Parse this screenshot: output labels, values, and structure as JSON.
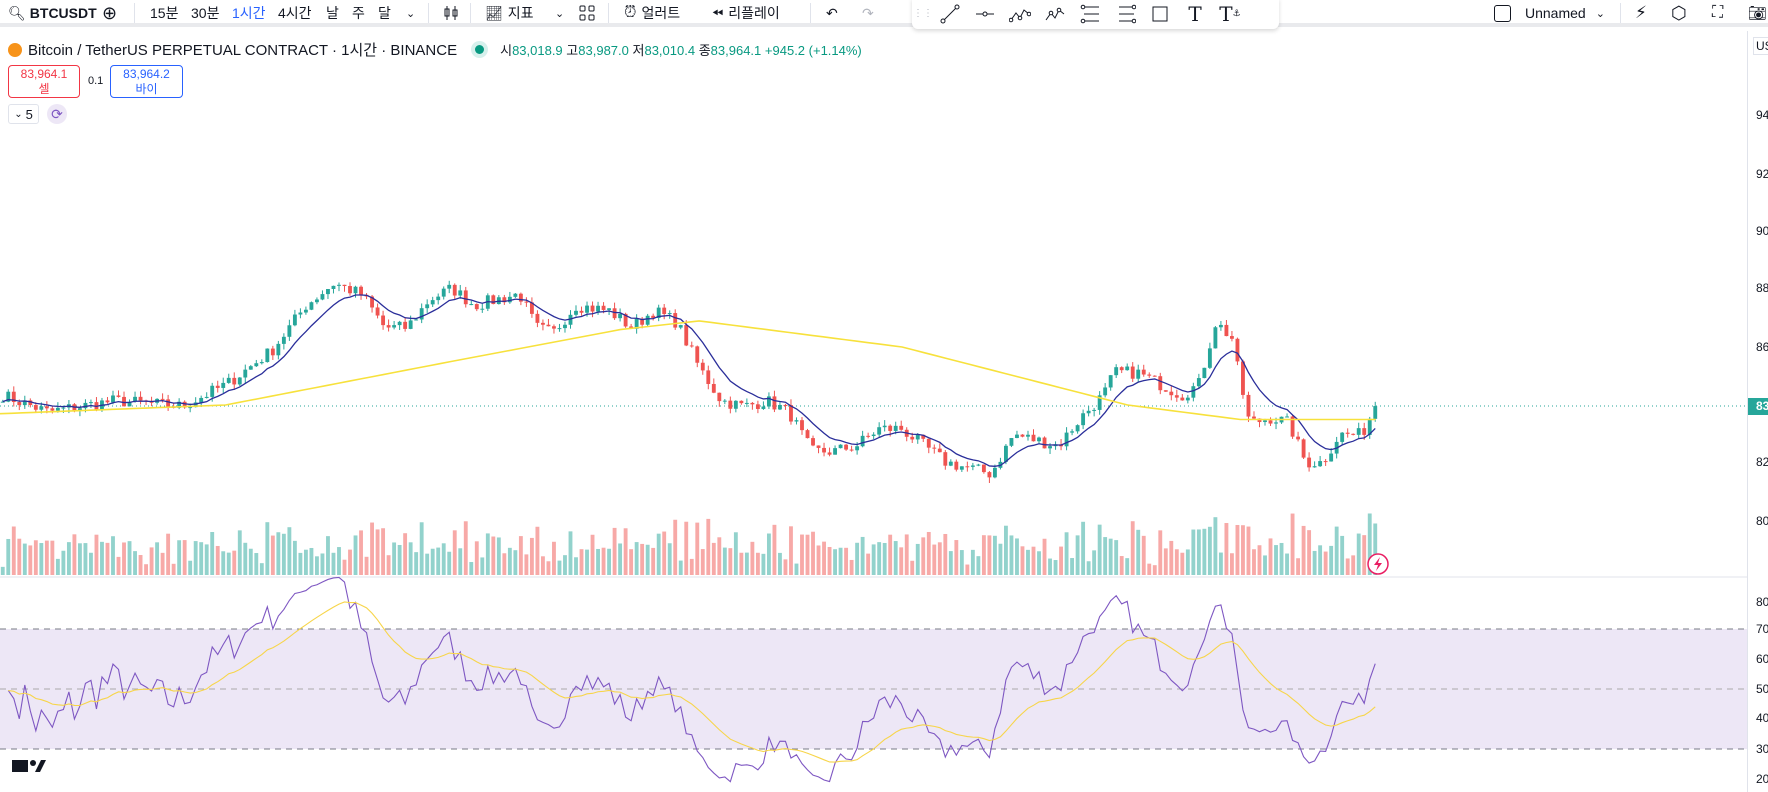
{
  "toolbar": {
    "symbol": "BTCUSDT",
    "intervals": [
      "15분",
      "30분",
      "1시간",
      "4시간",
      "날",
      "주",
      "달"
    ],
    "active_interval": "1시간",
    "indicators": "지표",
    "alert": "얼러트",
    "replay": "리플레이",
    "layout_name": "Unnamed"
  },
  "legend": {
    "title": "Bitcoin / TetherUS PERPETUAL CONTRACT · 1시간 · BINANCE",
    "o_label": "시",
    "o": "83,018.9",
    "h_label": "고",
    "h": "83,987.0",
    "l_label": "저",
    "l": "83,010.4",
    "c_label": "종",
    "c": "83,964.1",
    "change": "+945.2 (+1.14%)"
  },
  "trade": {
    "sell_price": "83,964.1",
    "sell_label": "셀",
    "spread": "0.1",
    "buy_price": "83,964.2",
    "buy_label": "바이"
  },
  "indicator_count": "5",
  "axis": {
    "currency": "US",
    "price_labels": [
      "94",
      "92",
      "90",
      "88",
      "86",
      "83",
      "82",
      "80"
    ],
    "rsi_labels": [
      "80",
      "70",
      "60",
      "50",
      "40",
      "30",
      "20"
    ],
    "last_price_label": "83"
  },
  "colors": {
    "up": "#26a69a",
    "down": "#ef5350",
    "ma_short": "#2a2e9a",
    "ma_long": "#f7e13c",
    "rsi": "#7e57c2",
    "rsi_ma": "#f7d54a",
    "rsi_band": "#ede7f6"
  },
  "chart_data": {
    "type": "candlestick",
    "ylim": [
      79000,
      95000
    ],
    "rsi_ylim": [
      20,
      80
    ],
    "close_keypoints": [
      [
        0,
        84340
      ],
      [
        40,
        83760
      ],
      [
        100,
        84150
      ],
      [
        160,
        83950
      ],
      [
        200,
        84730
      ],
      [
        240,
        85890
      ],
      [
        270,
        87440
      ],
      [
        295,
        88200
      ],
      [
        320,
        87800
      ],
      [
        340,
        86670
      ],
      [
        360,
        86670
      ],
      [
        380,
        87640
      ],
      [
        400,
        88020
      ],
      [
        420,
        87440
      ],
      [
        440,
        87640
      ],
      [
        460,
        87830
      ],
      [
        475,
        86670
      ],
      [
        490,
        86480
      ],
      [
        510,
        87440
      ],
      [
        540,
        87250
      ],
      [
        560,
        86670
      ],
      [
        580,
        87250
      ],
      [
        600,
        86860
      ],
      [
        620,
        85300
      ],
      [
        640,
        84150
      ],
      [
        660,
        83950
      ],
      [
        680,
        84150
      ],
      [
        700,
        83760
      ],
      [
        720,
        82400
      ],
      [
        740,
        82400
      ],
      [
        760,
        82600
      ],
      [
        780,
        83180
      ],
      [
        800,
        83180
      ],
      [
        820,
        82600
      ],
      [
        840,
        82020
      ],
      [
        860,
        81830
      ],
      [
        880,
        81630
      ],
      [
        900,
        82980
      ],
      [
        920,
        82790
      ],
      [
        940,
        82600
      ],
      [
        960,
        83570
      ],
      [
        980,
        84340
      ],
      [
        990,
        85120
      ],
      [
        1010,
        85120
      ],
      [
        1030,
        84730
      ],
      [
        1050,
        84340
      ],
      [
        1065,
        84730
      ],
      [
        1080,
        86860
      ],
      [
        1095,
        86280
      ],
      [
        1100,
        85120
      ],
      [
        1110,
        83370
      ],
      [
        1130,
        83570
      ],
      [
        1145,
        83370
      ],
      [
        1160,
        82020
      ],
      [
        1175,
        82020
      ],
      [
        1190,
        82980
      ],
      [
        1210,
        82980
      ],
      [
        1222,
        83964
      ]
    ],
    "ma_long_keypoints": [
      [
        0,
        83700
      ],
      [
        200,
        84000
      ],
      [
        400,
        85500
      ],
      [
        550,
        86600
      ],
      [
        620,
        86900
      ],
      [
        800,
        86000
      ],
      [
        1000,
        84000
      ],
      [
        1100,
        83500
      ],
      [
        1222,
        83500
      ]
    ]
  }
}
